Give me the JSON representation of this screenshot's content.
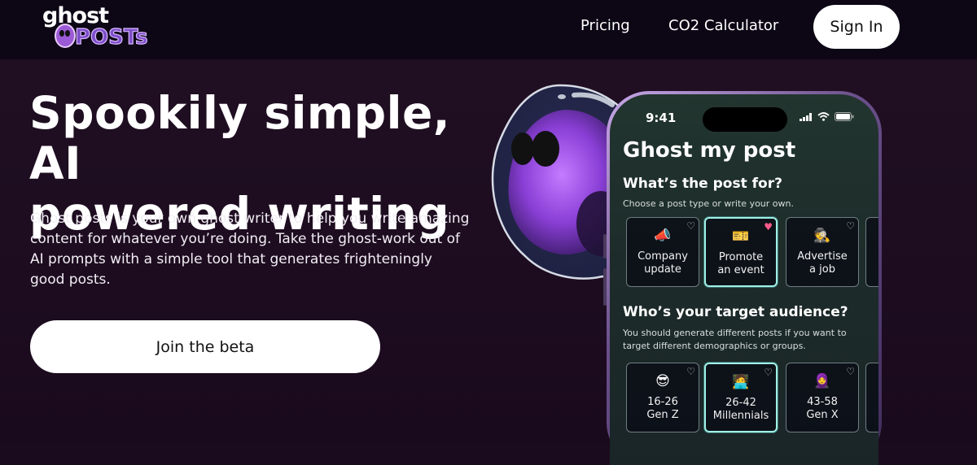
{
  "nav": {
    "logo_top": "ghost",
    "logo_bottom": "POSTs",
    "links": [
      "Pricing",
      "CO2 Calculator"
    ],
    "signin_label": "Sign In"
  },
  "hero": {
    "title_line1": "Spookily simple, AI",
    "title_line2": "powered writing",
    "description": "Ghost posts is your own ghost writer to help you write amazing content for whatever you’re doing. Take the ghost-work out of AI prompts with a simple tool that generates frighteningly good posts.",
    "cta_label": "Join the beta"
  },
  "phone": {
    "time": "9:41",
    "app_title": "Ghost my post",
    "section1": {
      "title": "What’s the post for?",
      "subtitle": "Choose a post type or write your own.",
      "cards": [
        {
          "emoji": "📣",
          "line1": "Company",
          "line2": "update",
          "favorite": false,
          "selected": false
        },
        {
          "emoji": "🎫",
          "line1": "Promote",
          "line2": "an event",
          "favorite": true,
          "selected": true
        },
        {
          "emoji": "🕵️",
          "line1": "Advertise",
          "line2": "a job",
          "favorite": false,
          "selected": false
        }
      ]
    },
    "section2": {
      "title": "Who’s your target audience?",
      "subtitle": "You should generate different posts if you want to target different demographics or groups.",
      "cards": [
        {
          "emoji": "😎",
          "line1": "16-26",
          "line2": "Gen Z",
          "favorite": false,
          "selected": false
        },
        {
          "emoji": "🧑‍💻",
          "line1": "26-42",
          "line2": "Millennials",
          "favorite": false,
          "selected": true
        },
        {
          "emoji": "🧕",
          "line1": "43-58",
          "line2": "Gen X",
          "favorite": false,
          "selected": false
        }
      ]
    },
    "heart_icon": "heart-icon"
  },
  "colors": {
    "background": "#1b0b1e",
    "nav_background": "#0c0615",
    "button": "#ffffff",
    "accent_selected": "#9ff0e8",
    "favorite": "#ff5b8a"
  }
}
